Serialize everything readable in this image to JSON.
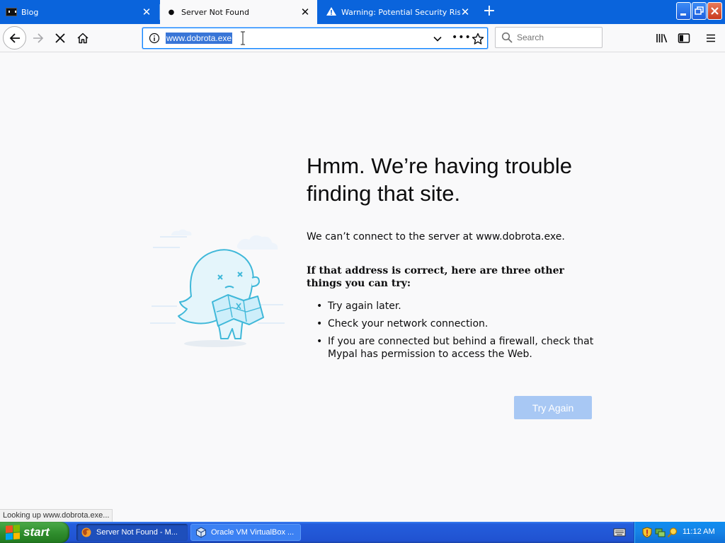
{
  "browser": {
    "tabs": [
      {
        "title": "Blog",
        "active": false
      },
      {
        "title": "Server Not Found",
        "active": true
      },
      {
        "title": "Warning: Potential Security Risk A",
        "active": false
      }
    ],
    "url": "www.dobrota.exe",
    "search_placeholder": "Search"
  },
  "page": {
    "title": "Hmm. We’re having trouble finding that site.",
    "description": "We can’t connect to the server at www.dobrota.exe.",
    "tips_heading": "If that address is correct, here are three other things you can try:",
    "tips": [
      "Try again later.",
      "Check your network connection.",
      "If you are connected but behind a firewall, check that Mypal has permission to access the Web."
    ],
    "try_again_label": "Try Again"
  },
  "status": "Looking up www.dobrota.exe...",
  "taskbar": {
    "start_label": "start",
    "tasks": [
      {
        "label": "Server Not Found - M...",
        "active": true
      },
      {
        "label": "Oracle VM VirtualBox ...",
        "active": false
      }
    ],
    "clock": "11:12 AM"
  },
  "colors": {
    "accent": "#0a84ff",
    "titlebar": "#0a64dc",
    "button_disabled": "#a8c8f4",
    "start_green": "#2d8a2b"
  }
}
